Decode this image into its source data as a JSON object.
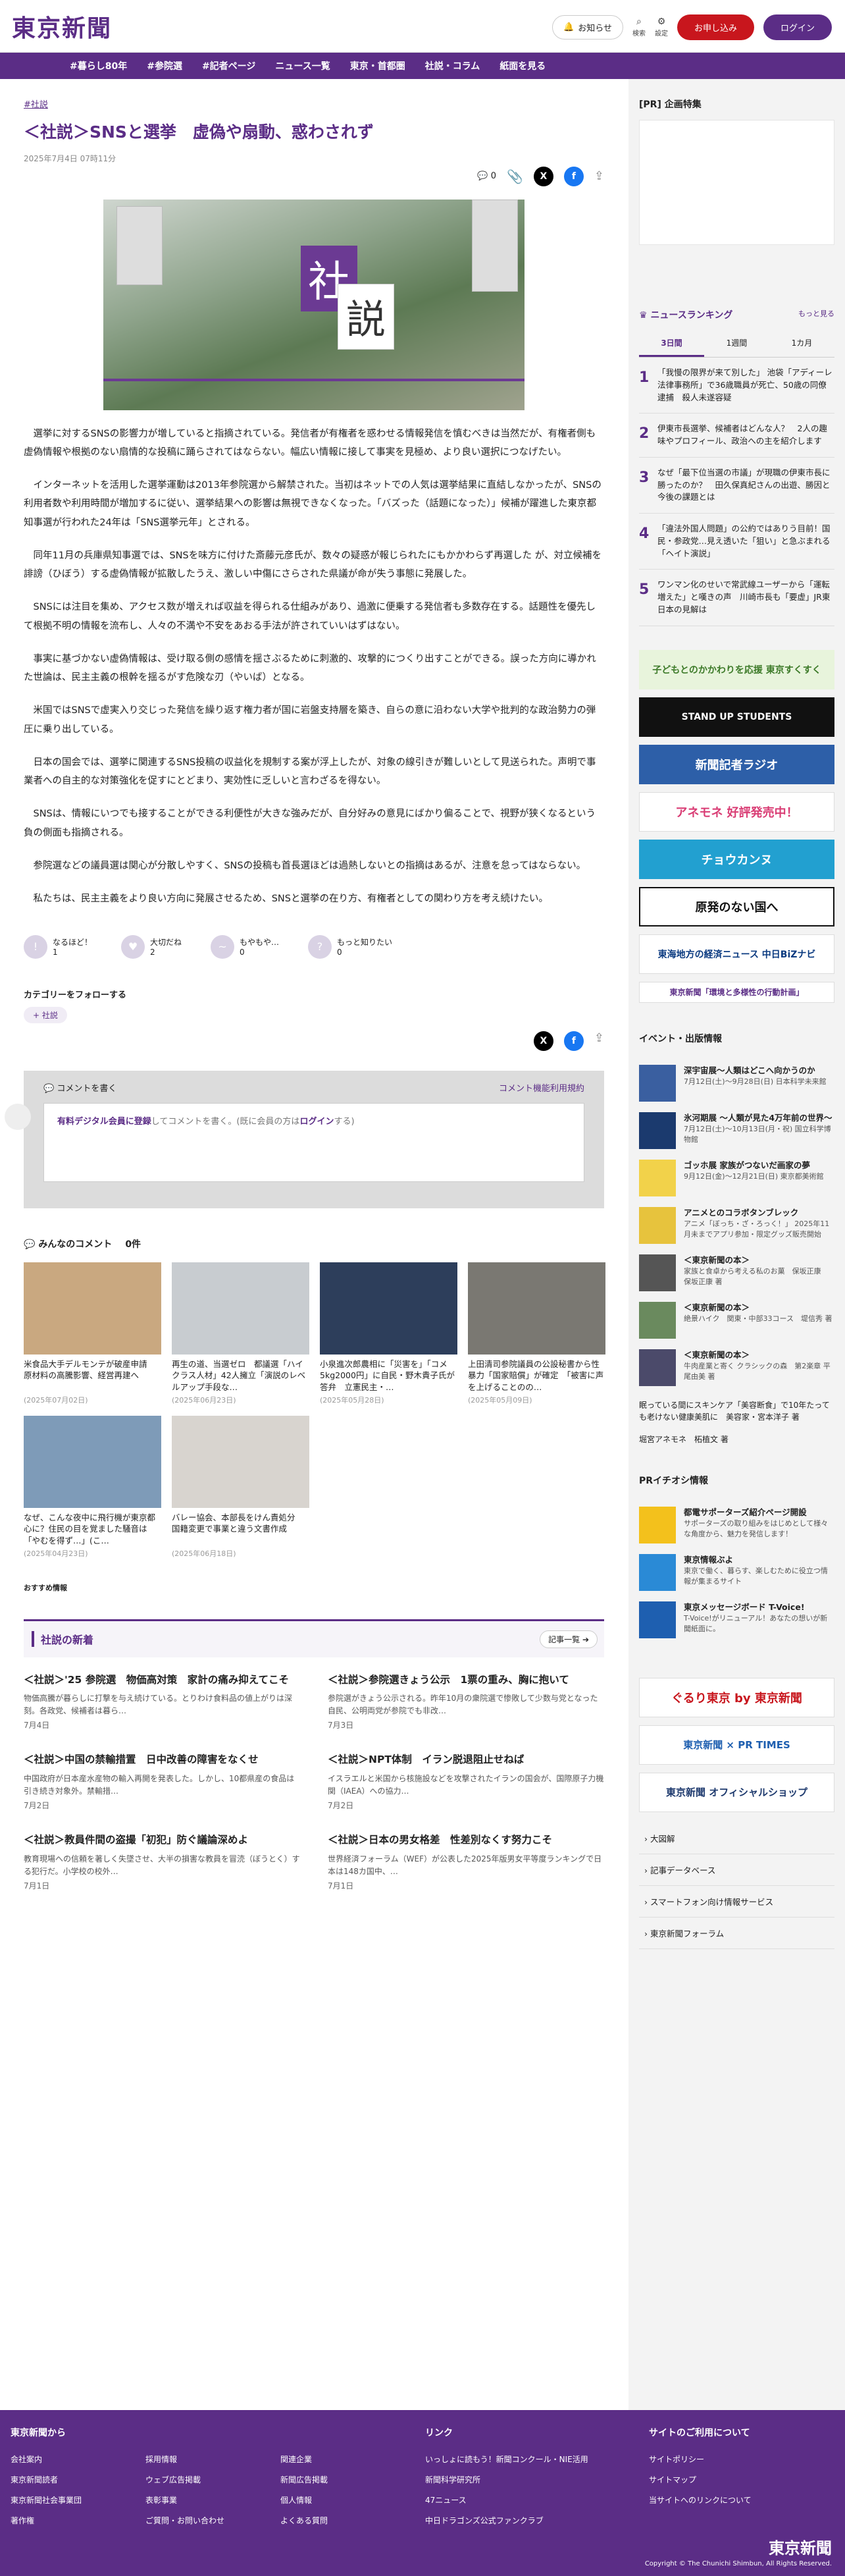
{
  "header": {
    "logo": "東京新聞",
    "notice": "お知らせ",
    "search": "検索",
    "settings": "設定",
    "signup": "お申し込み",
    "login": "ログイン"
  },
  "nav": [
    "#暮らし80年",
    "#参院選",
    "#記者ページ",
    "ニュース一覧",
    "東京・首都圏",
    "社説・コラム",
    "紙面を見る"
  ],
  "article": {
    "tag": "#社説",
    "title": "＜社説＞SNSと選挙　虚偽や扇動、惑わされず",
    "date": "2025年7月4日 07時11分",
    "comment_count": "0",
    "hero_kanji": [
      "社",
      "説"
    ],
    "paragraphs": [
      "選挙に対するSNSの影響力が増していると指摘されている。発信者が有権者を惑わせる情報発信を慎むべきは当然だが、有権者側も虚偽情報や根拠のない扇情的な投稿に踊らされてはならない。幅広い情報に接して事実を見極め、より良い選択につなげたい。",
      "インターネットを活用した選挙運動は2013年参院選から解禁された。当初はネットでの人気は選挙結果に直結しなかったが、SNSの利用者数や利用時間が増加するに従い、選挙結果への影響は無視できなくなった。「バズった（話題になった）」候補が躍進した東京都知事選が行われた24年は「SNS選挙元年」とされる。",
      "同年11月の兵庫県知事選では、SNSを味方に付けた斎藤元彦氏が、数々の疑惑が報じられたにもかかわらず再選した が、対立候補を誹謗（ひぼう）する虚偽情報が拡散したうえ、激しい中傷にさらされた県議が命が失う事態に発展した。",
      "SNSには注目を集め、アクセス数が増えれば収益を得られる仕組みがあり、過激に便乗する発信者も多数存在する。話題性を優先して根拠不明の情報を流布し、人々の不満や不安をあおる手法が許されていいはずはない。",
      "事実に基づかない虚偽情報は、受け取る側の感情を揺さぶるために刺激的、攻撃的につくり出すことができる。誤った方向に導かれた世論は、民主主義の根幹を揺るがす危険な刃（やいば）となる。",
      "米国ではSNSで虚実入り交じった発信を繰り返す権力者が国に岩盤支持層を築き、自らの意に沿わない大学や批判的な政治勢力の弾圧に乗り出している。",
      "日本の国会では、選挙に関連するSNS投稿の収益化を規制する案が浮上したが、対象の線引きが難しいとして見送られた。声明で事業者への自主的な対策強化を促すにとどまり、実効性に乏しいと言わざるを得ない。",
      "SNSは、情報にいつでも接することができる利便性が大きな強みだが、自分好みの意見にばかり偏ることで、視野が狭くなるという負の側面も指摘される。",
      "参院選などの議員選は関心が分散しやすく、SNSの投稿も首長選ほどは過熱しないとの指摘はあるが、注意を怠ってはならない。",
      "私たちは、民主主義をより良い方向に発展させるため、SNSと選挙の在り方、有権者としての関わり方を考え続けたい。"
    ],
    "reactions": [
      {
        "label": "なるほど！",
        "count": "1"
      },
      {
        "label": "大切だね",
        "count": "2"
      },
      {
        "label": "もやもや…",
        "count": "0"
      },
      {
        "label": "もっと知りたい",
        "count": "0"
      }
    ],
    "follow_label": "カテゴリーをフォローする",
    "follow_chip": "+ 社説"
  },
  "comment": {
    "title": "コメントを書く",
    "rules": "コメント機能利用規約",
    "prompt_link": "有料デジタル会員に登録",
    "prompt_mid": "してコメントを書く。(既に会員の方は",
    "prompt_login": "ログイン",
    "prompt_end": "する)"
  },
  "comments_count": {
    "label": "みんなのコメント",
    "count": "0件"
  },
  "related": [
    {
      "title": "米食品大手デルモンテが破産申請　原材料の高騰影響、経営再建へ",
      "date": "(2025年07月02日)"
    },
    {
      "title": "再生の道、当選ゼロ　都議選「ハイクラス人材」42人擁立「演説のレベルアップ手段な…",
      "date": "(2025年06月23日)"
    },
    {
      "title": "小泉進次郎農相に「災害を」「コメ5kg2000円」に自民・野木貴子氏が答弁　立憲民主・…",
      "date": "(2025年05月28日)"
    },
    {
      "title": "上田清司参院議員の公設秘書から性暴力「国家賠償」が確定　「被害に声を上げることのの…",
      "date": "(2025年05月09日)"
    },
    {
      "title": "なぜ、こんな夜中に飛行機が東京都心に？住民の目を覚ました騒音は「やむを得ず…」(こ…",
      "date": "(2025年04月23日)"
    },
    {
      "title": "バレー協会、本部長をけん責処分　国籍変更で事業と違う文書作成",
      "date": "(2025年06月18日)"
    }
  ],
  "recommend_label": "おすすめ情報",
  "editorials": {
    "header": "社説の新着",
    "more": "記事一覧",
    "items": [
      {
        "title": "＜社説＞'25 参院選　物価高対策　家計の痛み抑えてこそ",
        "snippet": "物価高騰が暮らしに打撃を与え続けている。とりわけ食料品の値上がりは深刻。各政党、候補者は暮ら…",
        "date": "7月4日"
      },
      {
        "title": "＜社説＞参院選きょう公示　1票の重み、胸に抱いて",
        "snippet": "参院選がきょう公示される。昨年10月の衆院選で惨敗して少数与党となった自民、公明両党が参院でも非改…",
        "date": "7月3日"
      },
      {
        "title": "＜社説＞中国の禁輸措置　日中改善の障害をなくせ",
        "snippet": "中国政府が日本産水産物の輸入再開を発表した。しかし、10都県産の食品は引き続き対象外。禁輸措…",
        "date": "7月2日"
      },
      {
        "title": "＜社説＞NPT体制　イラン脱退阻止せねば",
        "snippet": "イスラエルと米国から核施設などを攻撃されたイランの国会が、国際原子力機関（IAEA）への協力…",
        "date": "7月2日"
      },
      {
        "title": "＜社説＞教員件間の盗撮「初犯」防ぐ議論深めよ",
        "snippet": "教育現場への信頼を著しく失墜させ、大半の損害な教員を冒涜（ぼうとく）する犯行だ。小学校の校外…",
        "date": "7月1日"
      },
      {
        "title": "＜社説＞日本の男女格差　性差別なくす努力こそ",
        "snippet": "世界経済フォーラム（WEF）が公表した2025年版男女平等度ランキングで日本は148カ国中、…",
        "date": "7月1日"
      }
    ]
  },
  "sidebar": {
    "pr": "[PR] 企画特集",
    "ranking_title": "ニュースランキング",
    "ranking_more": "もっと見る",
    "tabs": [
      "3日間",
      "1週間",
      "1カ月"
    ],
    "ranking": [
      "「我慢の限界が来て別した」 池袋「アディーレ法律事務所」で36歳職員が死亡、50歳の同僚逮捕　殺人未遂容疑",
      "伊東市長選挙、候補者はどんな人？　2人の趣味やプロフィール、政治への主を紹介します",
      "なぜ「最下位当選の市議」が現職の伊東市長に勝ったのか？　田久保真紀さんの出遊、勝因と今後の課題とは",
      "「違法外国人問題」の公約ではありう目前！国民・参政党…見え透いた「狙い」と急ぶまれる「ヘイト演説」",
      "ワンマン化のせいで常武線ユーザーから「運転増えた」と嘆きの声　川崎市長も「要虚」JR東日本の見解は"
    ],
    "banners": [
      "子どもとのかかわりを応援 東京すくすく",
      "STAND UP STUDENTS",
      "新聞記者ラジオ",
      "アネモネ 好評発売中！",
      "チョウカンヌ",
      "原発のない国へ",
      "東海地方の経済ニュース 中日BiZナビ",
      "東京新聞「環境と多様性の行動計画」"
    ],
    "events_title": "イベント・出版情報",
    "events": [
      {
        "title": "深宇宙展〜人類はどこへ向かうのか",
        "sub": "7月12日(土)〜9月28日(日) 日本科学未来館"
      },
      {
        "title": "氷河期展 〜人類が見た4万年前の世界〜",
        "sub": "7月12日(土)〜10月13日(月・祝) 国立科学博物館"
      },
      {
        "title": "ゴッホ展 家族がつないだ画家の夢",
        "sub": "9月12日(金)〜12月21日(日) 東京都美術館"
      },
      {
        "title": "アニメとのコラボタンブレック",
        "sub": "アニメ「ぼっち・ざ・ろっく！」 2025年11月未までアプリ参加・限定グッズ販売開始"
      },
      {
        "title": "＜東京新聞の本＞",
        "sub": "家族と食卓から考える私のお菓　保坂正康　保坂正康 著"
      },
      {
        "title": "＜東京新聞の本＞",
        "sub": "絶景ハイク　関東・中部33コース　堤信秀 著"
      },
      {
        "title": "＜東京新聞の本＞",
        "sub": "牛肉産業と寄く クラシックの森　第2楽章 平尾由美 著"
      }
    ],
    "promo1": "眠っている間にスキンケア「美容断食」で10年たっても老けない健康美肌に　美容家・宮本洋子 著",
    "promo2": "堀宮アネモネ　柘植文 著",
    "pr_title": "PRイチオシ情報",
    "pr_items": [
      {
        "title": "都電サポーターズ紹介ページ開設",
        "sub": "サポーターズの取り組みをはじめとして様々な角度から、魅力を発信します！"
      },
      {
        "title": "東京情報ぶよ",
        "sub": "東京で働く、暮らす、楽しむために役立つ情報が集まるサイト"
      },
      {
        "title": "東京メッセージボード T-Voice!",
        "sub": "T-Voice!がリニューアル！あなたの想いが新聞紙面に。"
      }
    ],
    "bottom_banners": [
      "ぐるり東京 by 東京新聞",
      "東京新聞 × PR TIMES",
      "東京新聞 オフィシャルショップ"
    ],
    "links": [
      "大図解",
      "記事データベース",
      "スマートフォン向け情報サービス",
      "東京新聞フォーラム"
    ]
  },
  "footer": {
    "col1_title": "東京新聞から",
    "col1": [
      "会社案内",
      "東京新聞読者",
      "東京新聞社会事業団",
      "著作権",
      "採用情報",
      "ウェブ広告掲載",
      "表彰事業",
      "ご質問・お問い合わせ",
      "関連企業",
      "新聞広告掲載",
      "個人情報",
      "よくある質問"
    ],
    "col2_title": "リンク",
    "col2": [
      "いっしょに読もう！新聞コンクール・NIE活用",
      "新聞科学研究所",
      "47ニュース",
      "中日ドラゴンズ公式ファンクラブ"
    ],
    "col3_title": "サイトのご利用について",
    "col3": [
      "サイトポリシー",
      "サイトマップ",
      "当サイトへのリンクについて"
    ],
    "logo": "東京新聞",
    "copyright": "Copyright © The Chunichi Shimbun, All Rights Reserved."
  }
}
